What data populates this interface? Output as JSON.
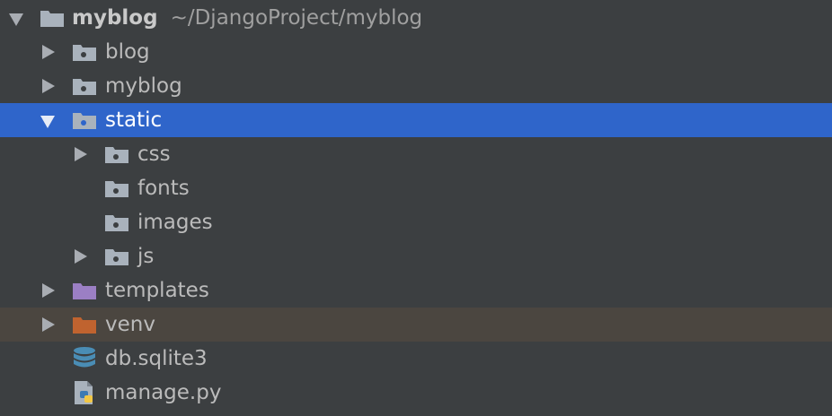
{
  "tree": {
    "root": {
      "name": "myblog",
      "path": "~/DjangoProject/myblog",
      "icon": "folder-icon",
      "expanded": true
    },
    "items": [
      {
        "label": "blog",
        "icon": "source-folder-icon",
        "expanded": false
      },
      {
        "label": "myblog",
        "icon": "source-folder-icon",
        "expanded": false
      },
      {
        "label": "static",
        "icon": "source-folder-icon",
        "expanded": true,
        "selected": true
      },
      {
        "label": "css",
        "icon": "source-folder-icon",
        "expanded": false
      },
      {
        "label": "fonts",
        "icon": "source-folder-icon"
      },
      {
        "label": "images",
        "icon": "source-folder-icon"
      },
      {
        "label": "js",
        "icon": "source-folder-icon",
        "expanded": false
      },
      {
        "label": "templates",
        "icon": "templates-folder-icon",
        "expanded": false
      },
      {
        "label": "venv",
        "icon": "excluded-folder-icon",
        "expanded": false
      },
      {
        "label": "db.sqlite3",
        "icon": "database-icon"
      },
      {
        "label": "manage.py",
        "icon": "python-file-icon"
      }
    ]
  },
  "colors": {
    "background": "#3c3f41",
    "selection": "#2f65ca",
    "excluded_row": "#4b4640",
    "folder": "#a9b2bc",
    "templates_folder": "#9b7fc4",
    "excluded_folder": "#c0632f",
    "database": "#4a8db5"
  }
}
